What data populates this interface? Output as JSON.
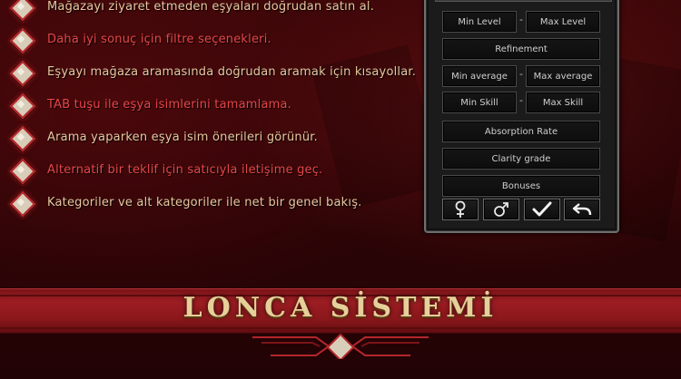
{
  "features": [
    {
      "text": "Mağazayı ziyaret etmeden eşyaları doğrudan satın al.",
      "tone": "gold"
    },
    {
      "text": "Daha iyi sonuç için filtre seçenekleri.",
      "tone": "red"
    },
    {
      "text": "Eşyayı mağaza aramasında doğrudan aramak için kısayollar.",
      "tone": "gold"
    },
    {
      "text": "TAB tuşu ile eşya isimlerini tamamlama.",
      "tone": "red"
    },
    {
      "text": "Arama yaparken eşya isim önerileri görünür.",
      "tone": "gold"
    },
    {
      "text": "Alternatif bir teklif için satıcıyla iletişime geç.",
      "tone": "red"
    },
    {
      "text": "Kategoriler ve alt kategoriler ile net bir genel bakış.",
      "tone": "gold"
    }
  ],
  "panel": {
    "min_level": "Min Level",
    "max_level": "Max Level",
    "refinement": "Refinement",
    "min_average": "Min average",
    "max_average": "Max average",
    "min_skill": "Min Skill",
    "max_skill": "Max Skill",
    "absorption_rate": "Absorption Rate",
    "clarity_grade": "Clarity grade",
    "bonuses": "Bonuses",
    "separator": "-",
    "icons": [
      "female-icon",
      "male-icon",
      "checkmark-icon",
      "back-arrow-icon"
    ]
  },
  "banner": {
    "title": "LONCA SİSTEMİ"
  },
  "colors": {
    "gold_text": "#e8c7a0",
    "red_text": "#e6474a",
    "banner_red": "#9c1d22",
    "title_gold": "#e7cf9a"
  }
}
